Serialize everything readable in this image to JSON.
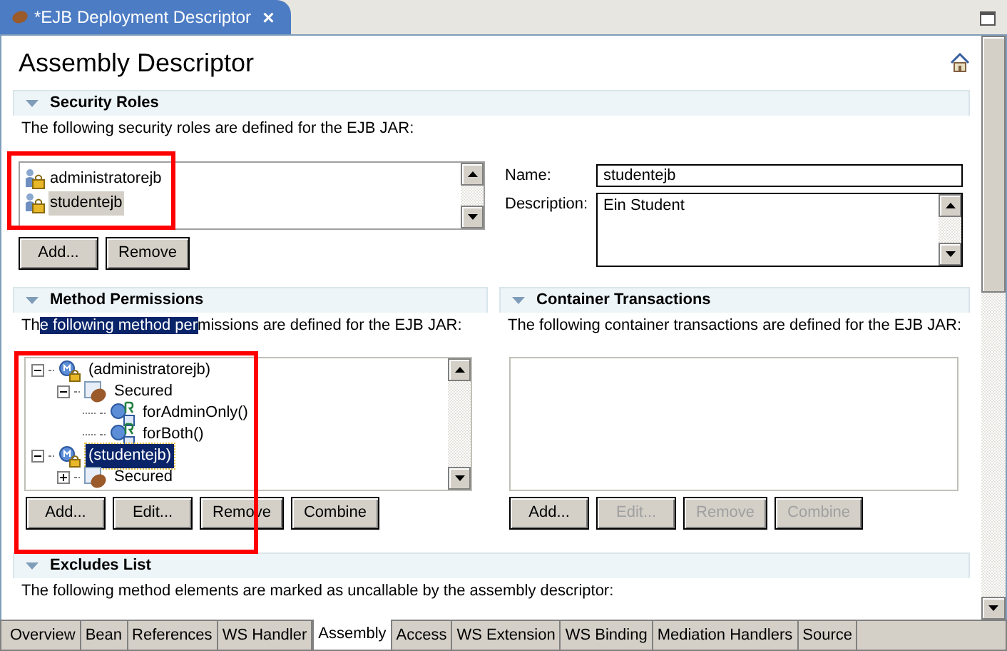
{
  "editor_tab": {
    "title": "*EJB Deployment Descriptor",
    "close": "×"
  },
  "page_title": "Assembly Descriptor",
  "security_roles": {
    "header": "Security Roles",
    "expanded": true,
    "description": "The following security roles are defined for the EJB JAR:",
    "roles": [
      {
        "name": "administratorejb",
        "selected": false
      },
      {
        "name": "studentejb",
        "selected": true
      }
    ],
    "buttons": [
      {
        "label": "Add...",
        "disabled": false
      },
      {
        "label": "Remove",
        "disabled": false
      }
    ],
    "name_label": "Name:",
    "name_value": "studentejb",
    "description_label": "Description:",
    "description_value": "Ein Student"
  },
  "method_permissions": {
    "header": "Method Permissions",
    "expanded": true,
    "description_parts": [
      {
        "text": "Th",
        "selected": false
      },
      {
        "text": "e following method per",
        "selected": true
      },
      {
        "text": "missions are defined for the EJB JAR:",
        "selected": false
      }
    ],
    "tree": [
      {
        "kind": "role",
        "label": "(administratorejb)",
        "expanded": true,
        "selected": false,
        "children": [
          {
            "kind": "group",
            "label": "Secured",
            "expanded": true,
            "selected": false,
            "children": [
              {
                "kind": "method",
                "label": "forAdminOnly()",
                "selected": false
              },
              {
                "kind": "method",
                "label": "forBoth()",
                "selected": false
              }
            ]
          }
        ]
      },
      {
        "kind": "role",
        "label": "(studentejb)",
        "expanded": true,
        "selected": true,
        "children": [
          {
            "kind": "group",
            "label": "Secured",
            "expanded": false,
            "selected": false
          }
        ]
      }
    ],
    "buttons": [
      {
        "label": "Add...",
        "disabled": false
      },
      {
        "label": "Edit...",
        "disabled": false
      },
      {
        "label": "Remove",
        "disabled": false
      },
      {
        "label": "Combine",
        "disabled": false
      }
    ]
  },
  "container_transactions": {
    "header": "Container Transactions",
    "expanded": true,
    "description": "The following container transactions are defined for the EJB JAR:",
    "buttons": [
      {
        "label": "Add...",
        "disabled": false
      },
      {
        "label": "Edit...",
        "disabled": true
      },
      {
        "label": "Remove",
        "disabled": true
      },
      {
        "label": "Combine",
        "disabled": true
      }
    ]
  },
  "excludes_list": {
    "header": "Excludes List",
    "expanded": true,
    "description": "The following method elements are marked as uncallable by the assembly descriptor:"
  },
  "bottom_tabs": [
    {
      "label": "Overview",
      "selected": false
    },
    {
      "label": "Bean",
      "selected": false
    },
    {
      "label": "References",
      "selected": false
    },
    {
      "label": "WS Handler",
      "selected": false
    },
    {
      "label": "Assembly",
      "selected": true
    },
    {
      "label": "Access",
      "selected": false
    },
    {
      "label": "WS Extension",
      "selected": false
    },
    {
      "label": "WS Binding",
      "selected": false
    },
    {
      "label": "Mediation Handlers",
      "selected": false
    },
    {
      "label": "Source",
      "selected": false
    }
  ]
}
